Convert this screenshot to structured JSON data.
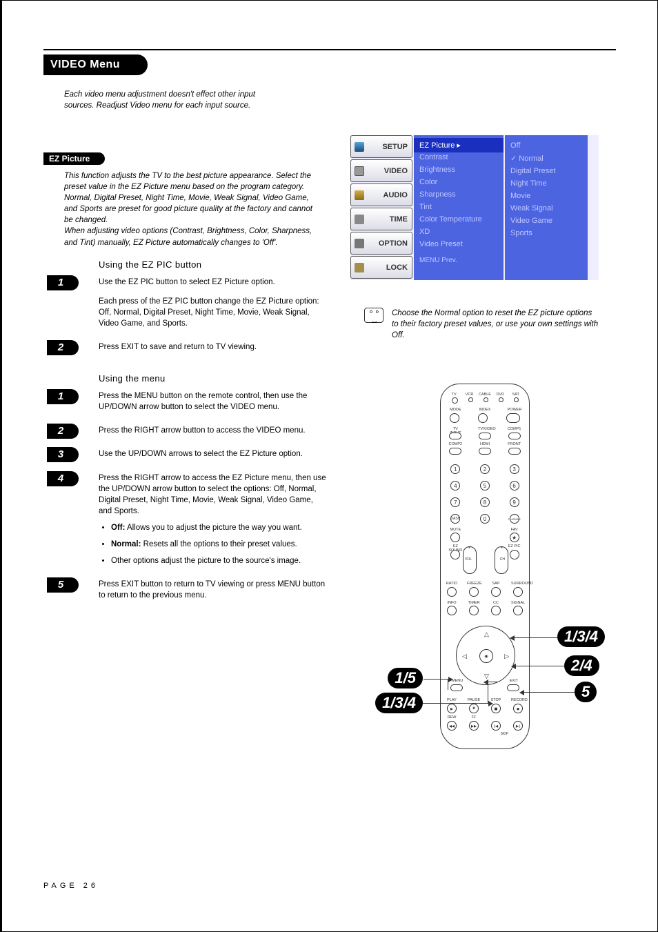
{
  "pageNumber": "PAGE 26",
  "sectionTitle": "VIDEO Menu",
  "intro": "Each video menu adjustment doesn't effect other input sources. Readjust Video menu for each input source.",
  "ezPicture": {
    "heading": "EZ Picture",
    "desc": "This function adjusts the TV to the best picture appearance. Select the preset value in the EZ Picture menu based on the program category.\nNormal, Digital Preset, Night Time, Movie, Weak Signal, Video Game, and Sports are preset for good picture quality at the factory and cannot be changed.\nWhen adjusting video options (Contrast, Brightness, Color, Sharpness, and Tint) manually, EZ Picture automatically changes to 'Off'.",
    "usingButtonHeading": "Using the EZ PIC button",
    "buttonSteps": [
      {
        "n": "1",
        "text": "Use the EZ PIC button to select EZ Picture option.",
        "extra": "Each press of the EZ PIC button change the EZ Picture option: Off, Normal, Digital Preset, Night Time, Movie, Weak Signal, Video Game, and Sports."
      },
      {
        "n": "2",
        "text": "Press EXIT to save and return to TV viewing."
      }
    ],
    "usingMenuHeading": "Using the menu",
    "menuSteps": [
      {
        "n": "1",
        "text": "Press the MENU button on the remote control, then use the UP/DOWN arrow button to select the VIDEO menu."
      },
      {
        "n": "2",
        "text": "Press the RIGHT arrow button to access the VIDEO menu."
      },
      {
        "n": "3",
        "text": "Use the UP/DOWN arrows to select the EZ Picture option."
      },
      {
        "n": "4",
        "text": "Press the RIGHT arrow to access the EZ Picture menu, then use the UP/DOWN arrow button to select the options: Off, Normal, Digital Preset, Night Time, Movie, Weak Signal, Video Game, and Sports.",
        "bullets": [
          {
            "lead": "Off:",
            "rest": " Allows you to adjust the picture the way you want."
          },
          {
            "lead": "Normal:",
            "rest": " Resets all the options to their preset values."
          },
          {
            "lead": "",
            "rest": "Other options adjust the picture to the source's image."
          }
        ]
      },
      {
        "n": "5",
        "text": "Press EXIT button to return to TV viewing or press MENU button to return to the previous menu."
      }
    ]
  },
  "osd": {
    "tabs": [
      "SETUP",
      "VIDEO",
      "AUDIO",
      "TIME",
      "OPTION",
      "LOCK"
    ],
    "col1": [
      "EZ Picture",
      "Contrast",
      "Brightness",
      "Color",
      "Sharpness",
      "Tint",
      "Color Temperature",
      "XD",
      "Video Preset"
    ],
    "col1Footer": "MENU Prev.",
    "col2": [
      "Off",
      "Normal",
      "Digital Preset",
      "Night Time",
      "Movie",
      "Weak Signal",
      "Video Game",
      "Sports"
    ],
    "col2Checked": "Normal"
  },
  "tip": "Choose the Normal option to reset the EZ picture options to their factory preset values, or use your own settings with Off.",
  "remote": {
    "topModes": [
      "TV",
      "VCR",
      "CABLE",
      "DVD",
      "SAT"
    ],
    "row2Labels": [
      "MODE",
      "INDEX",
      "POWER"
    ],
    "row3Labels": [
      "TV INPUT",
      "TV/VIDEO",
      "COMP1"
    ],
    "row4Labels": [
      "COMP2",
      "HDMI",
      "FRONT"
    ],
    "digits": [
      "1",
      "2",
      "3",
      "4",
      "5",
      "6",
      "7",
      "8",
      "9",
      "DASH",
      "0",
      "FLASHBK"
    ],
    "row5Labels": [
      "MUTE",
      "",
      "FAV"
    ],
    "row6Labels": [
      "EZ SOUND",
      "",
      "EZ PIC"
    ],
    "volch": {
      "vol": "VOL",
      "ch": "CH"
    },
    "row7Labels": [
      "RATIO",
      "FREEZE",
      "SAP",
      "SURROUND"
    ],
    "row8Labels": [
      "INFO",
      "TIMER",
      "CC",
      "SIGNAL"
    ],
    "navLabels": {
      "menu": "MENU",
      "exit": "EXIT"
    },
    "transportLabels": [
      "PLAY",
      "PAUSE",
      "STOP",
      "RECORD"
    ],
    "transport2Labels": [
      "REW",
      "FF",
      "",
      ""
    ],
    "skip": "SKIP"
  },
  "callouts": {
    "upArrow": "1/3/4",
    "rightArrow": "2/4",
    "exit": "5",
    "menu": "1/5",
    "downArrow": "1/3/4"
  }
}
